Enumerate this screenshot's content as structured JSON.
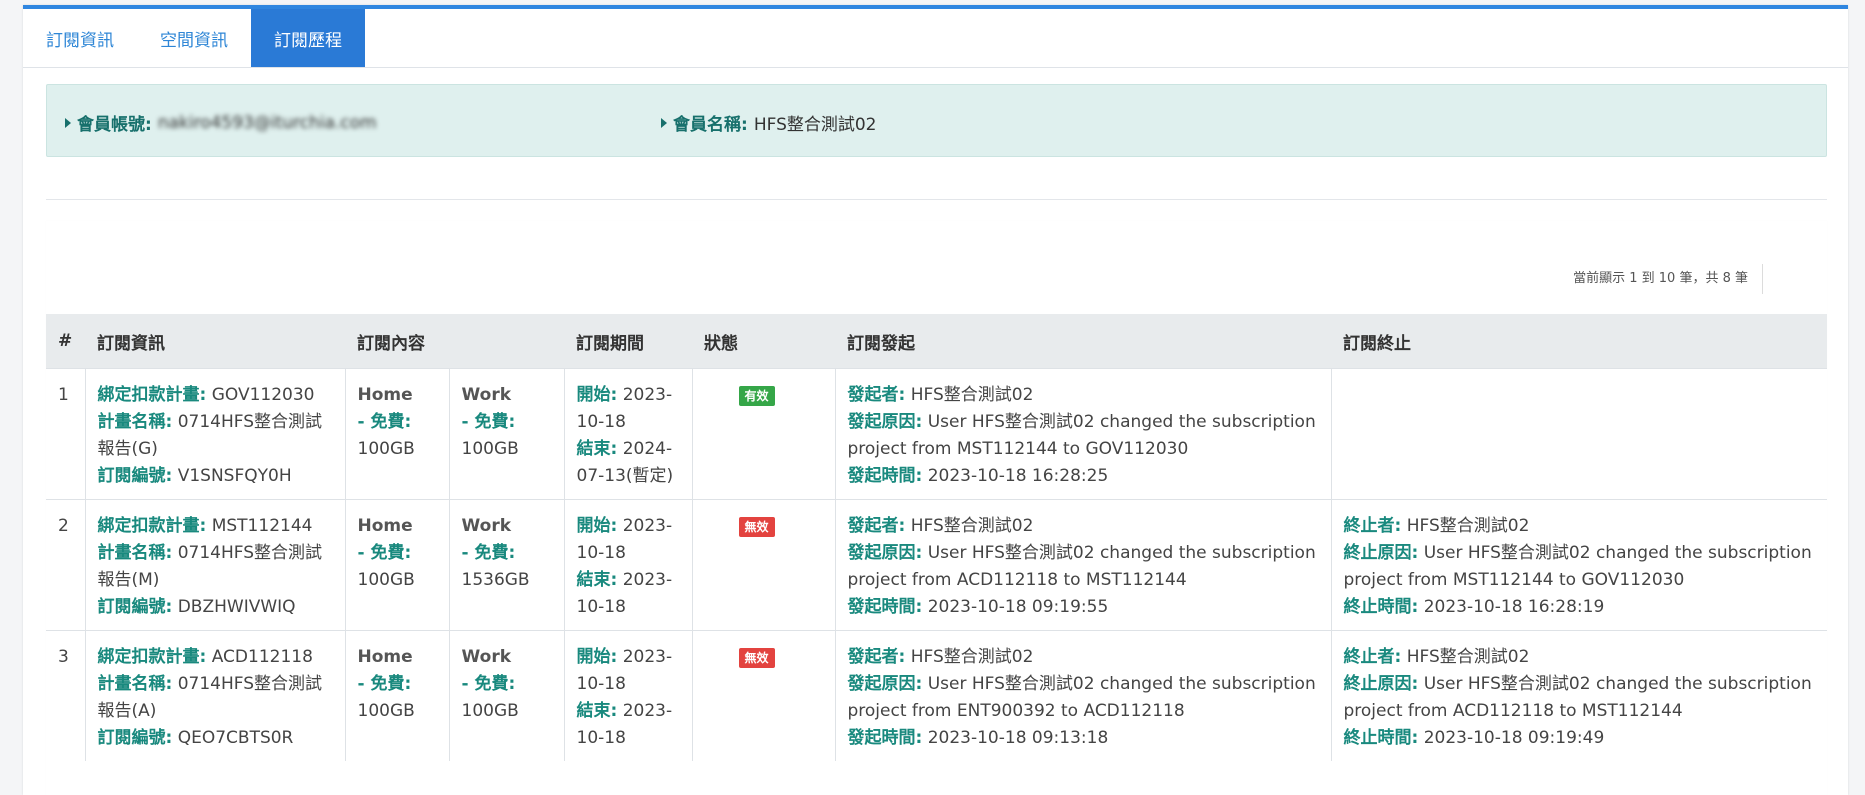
{
  "tabs": [
    {
      "label": "訂閱資訊",
      "active": false
    },
    {
      "label": "空間資訊",
      "active": false
    },
    {
      "label": "訂閱歷程",
      "active": true
    }
  ],
  "member": {
    "account_label": "會員帳號:",
    "account_value": "nakiro4593@iturchia.com",
    "name_label": "會員名稱:",
    "name_value": "HFS整合測試02"
  },
  "summary": "當前顯示 1 到 10 筆，共 8 筆",
  "table": {
    "headers": [
      "#",
      "訂閱資訊",
      "訂閱內容",
      "",
      "訂閱期間",
      "狀態",
      "訂閱發起",
      "訂閱終止"
    ],
    "labels": {
      "plan": "綁定扣款計畫:",
      "plan_name": "計畫名稱:",
      "sub_no": "訂閱編號:",
      "home": "Home",
      "work": "Work",
      "free": "- 免費:",
      "start": "開始:",
      "end": "結束:",
      "initiator": "發起者:",
      "init_reason": "發起原因:",
      "init_time": "發起時間:",
      "terminator": "終止者:",
      "term_reason": "終止原因:",
      "term_time": "終止時間:"
    },
    "rows": [
      {
        "num": "1",
        "plan": "GOV112030",
        "plan_name": "0714HFS整合測試報告(G)",
        "sub_no": "V1SNSFQY0H",
        "home_free": "100GB",
        "work_free": "100GB",
        "start": "2023-10-18",
        "end": "2024-07-13(暫定)",
        "status": "有效",
        "status_color": "#35a648",
        "initiator": "HFS整合測試02",
        "init_reason": "User HFS整合測試02 changed the subscription project from MST112144 to GOV112030",
        "init_time": "2023-10-18 16:28:25",
        "terminator": "",
        "term_reason": "",
        "term_time": ""
      },
      {
        "num": "2",
        "plan": "MST112144",
        "plan_name": "0714HFS整合測試報告(M)",
        "sub_no": "DBZHWIVWIQ",
        "home_free": "100GB",
        "work_free": "1536GB",
        "start": "2023-10-18",
        "end": "2023-10-18",
        "status": "無效",
        "status_color": "#e3433f",
        "initiator": "HFS整合測試02",
        "init_reason": "User HFS整合測試02 changed the subscription project from ACD112118 to MST112144",
        "init_time": "2023-10-18 09:19:55",
        "terminator": "HFS整合測試02",
        "term_reason": "User HFS整合測試02 changed the subscription project from MST112144 to GOV112030",
        "term_time": "2023-10-18 16:28:19"
      },
      {
        "num": "3",
        "plan": "ACD112118",
        "plan_name": "0714HFS整合測試報告(A)",
        "sub_no": "QEO7CBTS0R",
        "home_free": "100GB",
        "work_free": "100GB",
        "start": "2023-10-18",
        "end": "2023-10-18",
        "status": "無效",
        "status_color": "#e3433f",
        "initiator": "HFS整合測試02",
        "init_reason": "User HFS整合測試02 changed the subscription project from ENT900392 to ACD112118",
        "init_time": "2023-10-18 09:13:18",
        "terminator": "HFS整合測試02",
        "term_reason": "User HFS整合測試02 changed the subscription project from ACD112118 to MST112144",
        "term_time": "2023-10-18 09:19:49"
      }
    ]
  }
}
